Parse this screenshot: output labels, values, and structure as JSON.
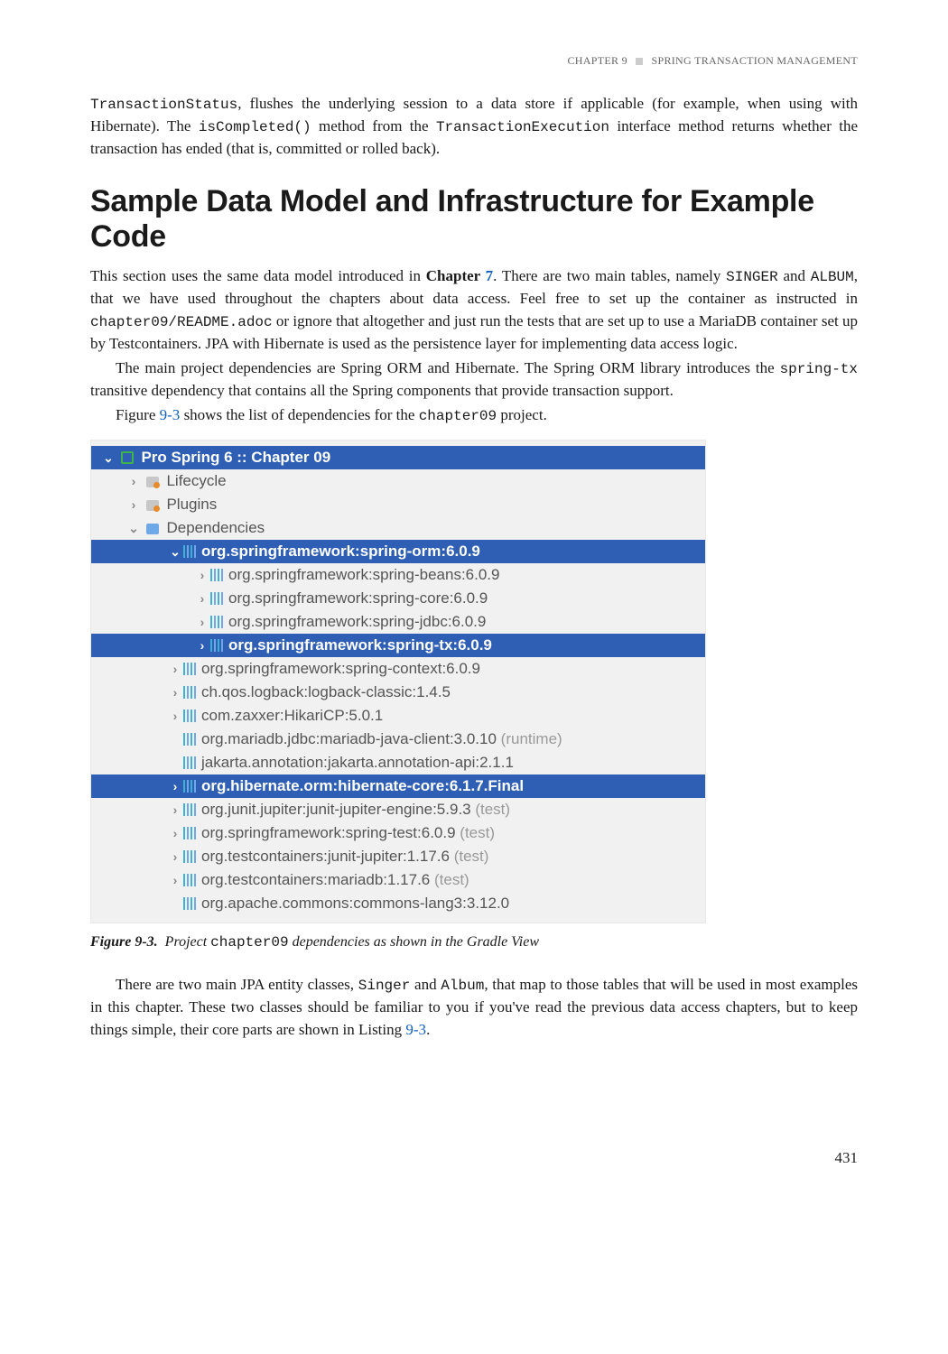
{
  "header": {
    "chapter_label": "CHAPTER 9",
    "chapter_title": "SPRING TRANSACTION MANAGEMENT"
  },
  "intro_para": {
    "part1": "TransactionStatus",
    "part2": ", flushes the underlying session to a data store if applicable (for example, when using with Hibernate). The ",
    "code2": "isCompleted()",
    "part3": " method from the ",
    "code3": "TransactionExecution",
    "part4": " interface method returns whether the transaction has ended (that is, committed or rolled back)."
  },
  "section_heading": "Sample Data Model and Infrastructure for Example Code",
  "para2": {
    "p1": "This section uses the same data model introduced in ",
    "ch7_bold": "Chapter ",
    "ch7_link": "7",
    "p2": ". There are two main tables, namely ",
    "singer": "SINGER",
    "p3": " and ",
    "album": "ALBUM",
    "p4": ", that we have used throughout the chapters about data access. Feel free to set up the container as instructed in ",
    "readme": "chapter09/README.adoc",
    "p5": " or ignore that altogether and just run the tests that are set up to use a MariaDB container set up by Testcontainers. JPA with Hibernate is used as the persistence layer for implementing data access logic."
  },
  "para3": {
    "p1": "The main project dependencies are Spring ORM and Hibernate. The Spring ORM library introduces the ",
    "springtx": "spring-tx",
    "p2": " transitive dependency that contains all the Spring components that provide transaction support."
  },
  "para4": {
    "p1": "Figure ",
    "figref": "9-3",
    "p2": " shows the list of dependencies for the ",
    "proj": "chapter09",
    "p3": " project."
  },
  "deps": {
    "root": "Pro Spring 6 :: Chapter 09",
    "lifecycle": "Lifecycle",
    "plugins": "Plugins",
    "dependencies": "Dependencies",
    "items": [
      {
        "indent": 3,
        "hl": true,
        "chev": "open",
        "label": "org.springframework:spring-orm:6.0.9",
        "scope": ""
      },
      {
        "indent": 4,
        "hl": false,
        "chev": "closed",
        "label": "org.springframework:spring-beans:6.0.9",
        "scope": ""
      },
      {
        "indent": 4,
        "hl": false,
        "chev": "closed",
        "label": "org.springframework:spring-core:6.0.9",
        "scope": ""
      },
      {
        "indent": 4,
        "hl": false,
        "chev": "closed",
        "label": "org.springframework:spring-jdbc:6.0.9",
        "scope": ""
      },
      {
        "indent": 4,
        "hl": true,
        "chev": "closed",
        "label": "org.springframework:spring-tx:6.0.9",
        "scope": ""
      },
      {
        "indent": 3,
        "hl": false,
        "chev": "closed",
        "label": "org.springframework:spring-context:6.0.9",
        "scope": ""
      },
      {
        "indent": 3,
        "hl": false,
        "chev": "closed",
        "label": "ch.qos.logback:logback-classic:1.4.5",
        "scope": ""
      },
      {
        "indent": 3,
        "hl": false,
        "chev": "closed",
        "label": "com.zaxxer:HikariCP:5.0.1",
        "scope": ""
      },
      {
        "indent": 3,
        "hl": false,
        "chev": "",
        "label": "org.mariadb.jdbc:mariadb-java-client:3.0.10",
        "scope": "(runtime)"
      },
      {
        "indent": 3,
        "hl": false,
        "chev": "",
        "label": "jakarta.annotation:jakarta.annotation-api:2.1.1",
        "scope": ""
      },
      {
        "indent": 3,
        "hl": true,
        "chev": "closed",
        "label": "org.hibernate.orm:hibernate-core:6.1.7.Final",
        "scope": ""
      },
      {
        "indent": 3,
        "hl": false,
        "chev": "closed",
        "label": "org.junit.jupiter:junit-jupiter-engine:5.9.3",
        "scope": "(test)"
      },
      {
        "indent": 3,
        "hl": false,
        "chev": "closed",
        "label": "org.springframework:spring-test:6.0.9",
        "scope": "(test)"
      },
      {
        "indent": 3,
        "hl": false,
        "chev": "closed",
        "label": "org.testcontainers:junit-jupiter:1.17.6",
        "scope": "(test)"
      },
      {
        "indent": 3,
        "hl": false,
        "chev": "closed",
        "label": "org.testcontainers:mariadb:1.17.6",
        "scope": "(test)"
      },
      {
        "indent": 3,
        "hl": false,
        "chev": "",
        "label": "org.apache.commons:commons-lang3:3.12.0",
        "scope": ""
      }
    ]
  },
  "figure_caption": {
    "label": "Figure 9-3.",
    "pre": "Project ",
    "code": "chapter09",
    "post": " dependencies as shown in the Gradle View"
  },
  "para5": {
    "p1": "There are two main JPA entity classes, ",
    "c1": "Singer",
    "p2": " and ",
    "c2": "Album",
    "p3": ", that map to those tables that will be used in most examples in this chapter. These two classes should be familiar to you if you've read the previous data access chapters, but to keep things simple, their core parts are shown in Listing ",
    "listref": "9-3",
    "p4": "."
  },
  "page_number": "431"
}
